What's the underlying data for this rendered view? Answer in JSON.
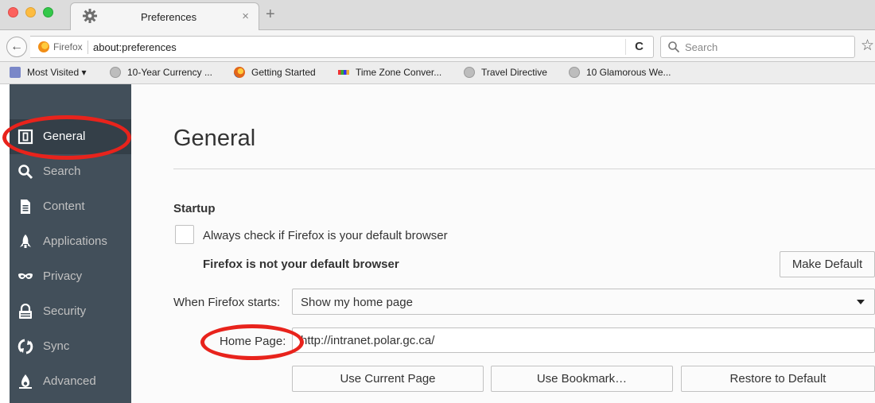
{
  "tab": {
    "title": "Preferences",
    "close": "×",
    "new_tab": "+"
  },
  "navbar": {
    "back": "←",
    "identity_label": "Firefox",
    "url": "about:preferences",
    "reload": "C",
    "search_placeholder": "Search",
    "bookmark_star": "☆"
  },
  "bookmarks": [
    {
      "label": "Most Visited ▾",
      "icon": "folder-icon"
    },
    {
      "label": "10-Year Currency ...",
      "icon": "globe-icon"
    },
    {
      "label": "Getting Started",
      "icon": "firefox-icon"
    },
    {
      "label": "Time Zone Conver...",
      "icon": "timezone-icon"
    },
    {
      "label": "Travel Directive",
      "icon": "globe-icon"
    },
    {
      "label": "10 Glamorous We...",
      "icon": "globe-icon"
    }
  ],
  "sidebar": {
    "items": [
      {
        "label": "General",
        "icon": "general-icon",
        "active": true
      },
      {
        "label": "Search",
        "icon": "search-icon"
      },
      {
        "label": "Content",
        "icon": "content-icon"
      },
      {
        "label": "Applications",
        "icon": "applications-icon"
      },
      {
        "label": "Privacy",
        "icon": "privacy-mask-icon"
      },
      {
        "label": "Security",
        "icon": "security-lock-icon"
      },
      {
        "label": "Sync",
        "icon": "sync-icon"
      },
      {
        "label": "Advanced",
        "icon": "advanced-icon"
      }
    ]
  },
  "main": {
    "title": "General",
    "startup": {
      "heading": "Startup",
      "default_check_label": "Always check if Firefox is your default browser",
      "default_check_checked": false,
      "not_default_text": "Firefox is not your default browser",
      "make_default_button": "Make Default",
      "when_starts_label": "When Firefox starts:",
      "when_starts_value": "Show my home page",
      "home_page_label": "Home Page:",
      "home_page_value": "http://intranet.polar.gc.ca/",
      "use_current_button": "Use Current Page",
      "use_bookmark_button": "Use Bookmark…",
      "restore_default_button": "Restore to Default"
    }
  },
  "colors": {
    "sidebar_bg": "#424f5a",
    "sidebar_active_bg": "#343f48",
    "annotation_red": "#e8231c"
  }
}
